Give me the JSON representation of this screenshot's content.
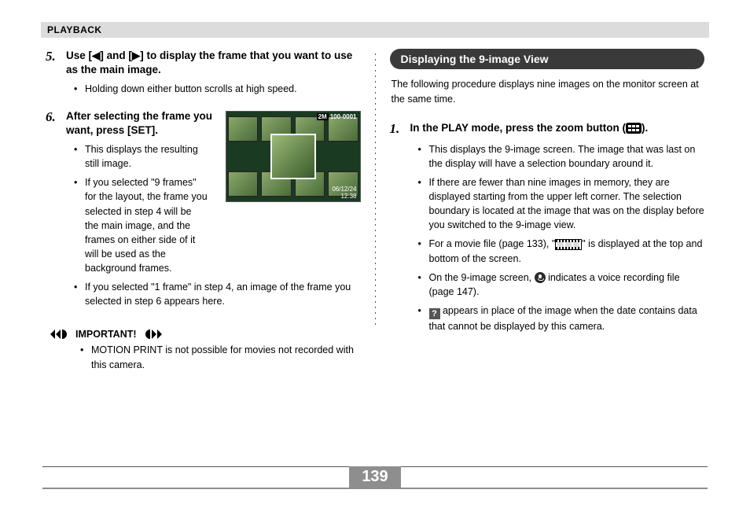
{
  "header": {
    "section": "PLAYBACK"
  },
  "page_number": "139",
  "left": {
    "step5": {
      "num": "5.",
      "head": "Use [◀] and [▶] to display the frame that you want to use as the main image.",
      "bullets": [
        "Holding down either button scrolls at high speed."
      ]
    },
    "step6": {
      "num": "6.",
      "head": "After selecting the frame you want, press [SET].",
      "bullets": [
        "This displays the resulting still image.",
        "If you selected \"9 frames\" for the layout, the frame you selected in step 4 will be the main image, and the frames on either side of it will be used as the background frames.",
        "If you selected \"1 frame\" in step 4, an image of the frame you selected in step 6 appears here."
      ]
    },
    "important": {
      "label": "IMPORTANT!",
      "bullets": [
        "MOTION PRINT is not possible for movies not recorded with this camera."
      ]
    },
    "preview_overlay": {
      "top": "100-0001",
      "date": "06/12/24",
      "time": "12:38",
      "size_badge": "2M"
    }
  },
  "right": {
    "section_title": "Displaying the 9-image View",
    "intro": "The following procedure displays nine images on the monitor screen at the same time.",
    "step1": {
      "num": "1.",
      "head_a": "In the PLAY mode, press the zoom button (",
      "head_b": ").",
      "bullets": {
        "b1": "This displays the 9-image screen. The image that was last on the display will have a selection boundary around it.",
        "b2": "If there are fewer than nine images in memory, they are displayed starting from the upper left corner. The selection boundary is located at the image that was on the display before you switched to the 9-image view.",
        "b3a": "For a movie file (page 133), \"",
        "b3b": "\" is displayed at the top and bottom of the screen.",
        "b4a": "On the 9-image screen, ",
        "b4b": " indicates a voice recording file (page 147).",
        "b5a": "",
        "b5b": " appears in place of the image when the date contains data that cannot be displayed by this camera."
      }
    }
  }
}
